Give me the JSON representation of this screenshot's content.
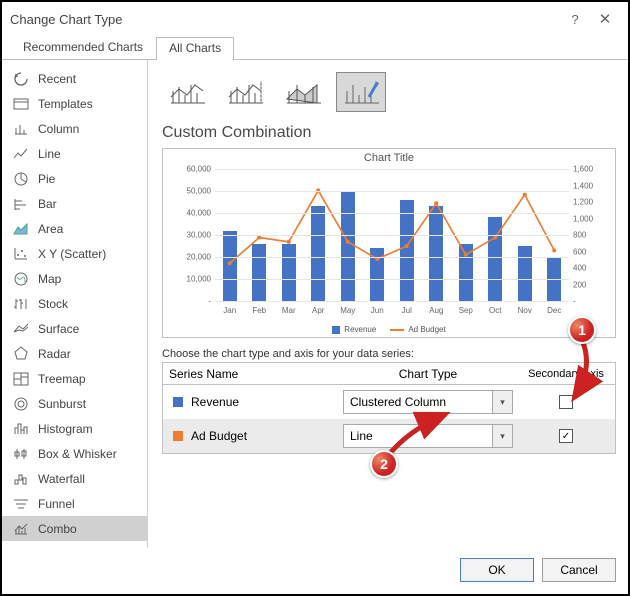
{
  "dialog": {
    "title": "Change Chart Type"
  },
  "tabs": {
    "recommended": "Recommended Charts",
    "all": "All Charts"
  },
  "sidebar": {
    "items": [
      {
        "label": "Recent"
      },
      {
        "label": "Templates"
      },
      {
        "label": "Column"
      },
      {
        "label": "Line"
      },
      {
        "label": "Pie"
      },
      {
        "label": "Bar"
      },
      {
        "label": "Area"
      },
      {
        "label": "X Y (Scatter)"
      },
      {
        "label": "Map"
      },
      {
        "label": "Stock"
      },
      {
        "label": "Surface"
      },
      {
        "label": "Radar"
      },
      {
        "label": "Treemap"
      },
      {
        "label": "Sunburst"
      },
      {
        "label": "Histogram"
      },
      {
        "label": "Box & Whisker"
      },
      {
        "label": "Waterfall"
      },
      {
        "label": "Funnel"
      },
      {
        "label": "Combo"
      }
    ]
  },
  "combo_title": "Custom Combination",
  "preview": {
    "title": "Chart Title",
    "legend": {
      "s1": "Revenue",
      "s2": "Ad Budget"
    }
  },
  "chart_data": {
    "type": "combo",
    "categories": [
      "Jan",
      "Feb",
      "Mar",
      "Apr",
      "May",
      "Jun",
      "Jul",
      "Aug",
      "Sep",
      "Oct",
      "Nov",
      "Dec"
    ],
    "ylim_left": [
      0,
      60000
    ],
    "yticks_left": [
      "60,000",
      "50,000",
      "40,000",
      "30,000",
      "20,000",
      "10,000",
      "-"
    ],
    "ylim_right": [
      0,
      1600
    ],
    "yticks_right": [
      "1,600",
      "1,400",
      "1,200",
      "1,000",
      "800",
      "600",
      "400",
      "200",
      "-"
    ],
    "series": [
      {
        "name": "Revenue",
        "type": "bar",
        "axis": "primary",
        "values": [
          32000,
          26000,
          26000,
          43000,
          50000,
          24000,
          46000,
          43000,
          26000,
          38000,
          25000,
          20000
        ]
      },
      {
        "name": "Ad Budget",
        "type": "line",
        "axis": "secondary",
        "values": [
          500,
          800,
          750,
          1350,
          750,
          550,
          700,
          1200,
          600,
          800,
          1300,
          650
        ]
      }
    ]
  },
  "configure_label": "Choose the chart type and axis for your data series:",
  "series_table": {
    "head": {
      "name": "Series Name",
      "type": "Chart Type",
      "axis": "Secondary Axis"
    },
    "rows": [
      {
        "name": "Revenue",
        "swatch": "#4472c4",
        "type": "Clustered Column",
        "axis_checked": false
      },
      {
        "name": "Ad Budget",
        "swatch": "#ed7d31",
        "type": "Line",
        "axis_checked": true
      }
    ]
  },
  "footer": {
    "ok": "OK",
    "cancel": "Cancel"
  },
  "badges": {
    "b1": "1",
    "b2": "2"
  }
}
